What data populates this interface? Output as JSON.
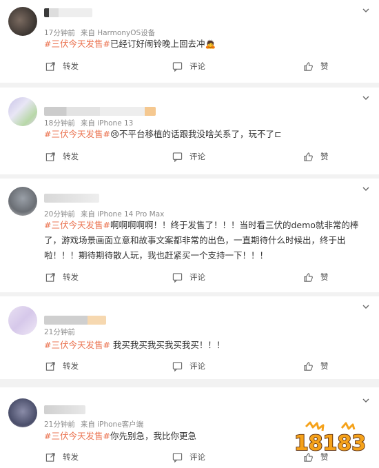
{
  "actions": {
    "repost": "转发",
    "comment": "评论",
    "like": "赞"
  },
  "comments": [
    {
      "time": "17分钟前",
      "source": "来自 HarmonyOS设备",
      "topic": "#三伏今天发售#",
      "text": "已经订好闹铃晚上回去冲",
      "emoji": "🙇",
      "name_partial": "F"
    },
    {
      "time": "18分钟前",
      "source": "来自 iPhone 13",
      "topic": "#三伏今天发售#",
      "text": "😢不平台移植的话跟我没啥关系了，玩不了",
      "emoji": "⊏",
      "name_partial": ""
    },
    {
      "time": "20分钟前",
      "source": "来自 iPhone 14 Pro Max",
      "topic": "#三伏今天发售#",
      "text": "啊啊啊啊啊！！终于发售了！！！当时看三伏的demo就非常的棒了，游戏场景画面立意和故事文案都非常的出色，一直期待什么时候出，终于出啦！！！期待期待散人玩，我也赶紧买一个支持一下！！！",
      "emoji": "",
      "name_partial": ""
    },
    {
      "time": "21分钟前",
      "source": "",
      "topic": "#三伏今天发售#",
      "text": " 我买我买我买我买我买！！！",
      "emoji": "",
      "name_partial": "花只否啊啊"
    },
    {
      "time": "21分钟前",
      "source": "来自 iPhone客户端",
      "topic": "#三伏今天发售#",
      "text": "你先别急，我比你更急",
      "emoji": "",
      "name_partial": "喵喵酱"
    }
  ],
  "watermark": {
    "text": "18183"
  },
  "colors": {
    "topic": "#eb7350",
    "meta": "#8a8a8a",
    "background": "#f2f2f2",
    "brand_orange": "#f5a21b"
  }
}
